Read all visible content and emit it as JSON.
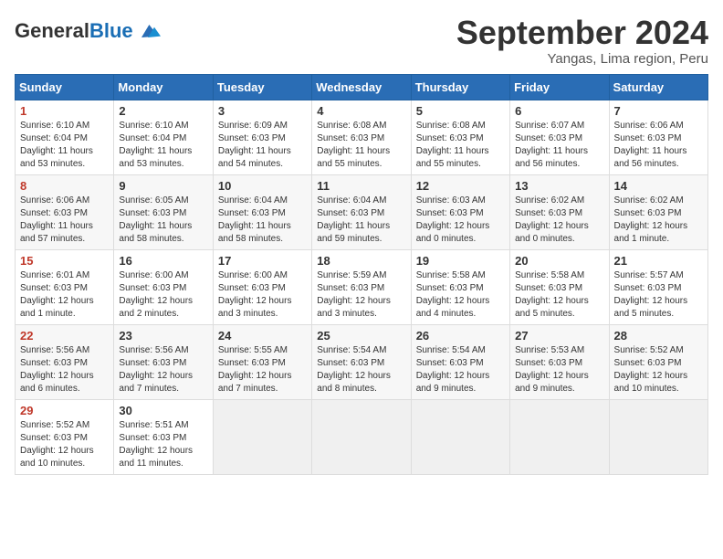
{
  "header": {
    "logo_general": "General",
    "logo_blue": "Blue",
    "month_title": "September 2024",
    "location": "Yangas, Lima region, Peru"
  },
  "calendar": {
    "weekdays": [
      "Sunday",
      "Monday",
      "Tuesday",
      "Wednesday",
      "Thursday",
      "Friday",
      "Saturday"
    ],
    "weeks": [
      [
        {
          "day": "1",
          "info": "Sunrise: 6:10 AM\nSunset: 6:04 PM\nDaylight: 11 hours\nand 53 minutes."
        },
        {
          "day": "2",
          "info": "Sunrise: 6:10 AM\nSunset: 6:04 PM\nDaylight: 11 hours\nand 53 minutes."
        },
        {
          "day": "3",
          "info": "Sunrise: 6:09 AM\nSunset: 6:03 PM\nDaylight: 11 hours\nand 54 minutes."
        },
        {
          "day": "4",
          "info": "Sunrise: 6:08 AM\nSunset: 6:03 PM\nDaylight: 11 hours\nand 55 minutes."
        },
        {
          "day": "5",
          "info": "Sunrise: 6:08 AM\nSunset: 6:03 PM\nDaylight: 11 hours\nand 55 minutes."
        },
        {
          "day": "6",
          "info": "Sunrise: 6:07 AM\nSunset: 6:03 PM\nDaylight: 11 hours\nand 56 minutes."
        },
        {
          "day": "7",
          "info": "Sunrise: 6:06 AM\nSunset: 6:03 PM\nDaylight: 11 hours\nand 56 minutes."
        }
      ],
      [
        {
          "day": "8",
          "info": "Sunrise: 6:06 AM\nSunset: 6:03 PM\nDaylight: 11 hours\nand 57 minutes."
        },
        {
          "day": "9",
          "info": "Sunrise: 6:05 AM\nSunset: 6:03 PM\nDaylight: 11 hours\nand 58 minutes."
        },
        {
          "day": "10",
          "info": "Sunrise: 6:04 AM\nSunset: 6:03 PM\nDaylight: 11 hours\nand 58 minutes."
        },
        {
          "day": "11",
          "info": "Sunrise: 6:04 AM\nSunset: 6:03 PM\nDaylight: 11 hours\nand 59 minutes."
        },
        {
          "day": "12",
          "info": "Sunrise: 6:03 AM\nSunset: 6:03 PM\nDaylight: 12 hours\nand 0 minutes."
        },
        {
          "day": "13",
          "info": "Sunrise: 6:02 AM\nSunset: 6:03 PM\nDaylight: 12 hours\nand 0 minutes."
        },
        {
          "day": "14",
          "info": "Sunrise: 6:02 AM\nSunset: 6:03 PM\nDaylight: 12 hours\nand 1 minute."
        }
      ],
      [
        {
          "day": "15",
          "info": "Sunrise: 6:01 AM\nSunset: 6:03 PM\nDaylight: 12 hours\nand 1 minute."
        },
        {
          "day": "16",
          "info": "Sunrise: 6:00 AM\nSunset: 6:03 PM\nDaylight: 12 hours\nand 2 minutes."
        },
        {
          "day": "17",
          "info": "Sunrise: 6:00 AM\nSunset: 6:03 PM\nDaylight: 12 hours\nand 3 minutes."
        },
        {
          "day": "18",
          "info": "Sunrise: 5:59 AM\nSunset: 6:03 PM\nDaylight: 12 hours\nand 3 minutes."
        },
        {
          "day": "19",
          "info": "Sunrise: 5:58 AM\nSunset: 6:03 PM\nDaylight: 12 hours\nand 4 minutes."
        },
        {
          "day": "20",
          "info": "Sunrise: 5:58 AM\nSunset: 6:03 PM\nDaylight: 12 hours\nand 5 minutes."
        },
        {
          "day": "21",
          "info": "Sunrise: 5:57 AM\nSunset: 6:03 PM\nDaylight: 12 hours\nand 5 minutes."
        }
      ],
      [
        {
          "day": "22",
          "info": "Sunrise: 5:56 AM\nSunset: 6:03 PM\nDaylight: 12 hours\nand 6 minutes."
        },
        {
          "day": "23",
          "info": "Sunrise: 5:56 AM\nSunset: 6:03 PM\nDaylight: 12 hours\nand 7 minutes."
        },
        {
          "day": "24",
          "info": "Sunrise: 5:55 AM\nSunset: 6:03 PM\nDaylight: 12 hours\nand 7 minutes."
        },
        {
          "day": "25",
          "info": "Sunrise: 5:54 AM\nSunset: 6:03 PM\nDaylight: 12 hours\nand 8 minutes."
        },
        {
          "day": "26",
          "info": "Sunrise: 5:54 AM\nSunset: 6:03 PM\nDaylight: 12 hours\nand 9 minutes."
        },
        {
          "day": "27",
          "info": "Sunrise: 5:53 AM\nSunset: 6:03 PM\nDaylight: 12 hours\nand 9 minutes."
        },
        {
          "day": "28",
          "info": "Sunrise: 5:52 AM\nSunset: 6:03 PM\nDaylight: 12 hours\nand 10 minutes."
        }
      ],
      [
        {
          "day": "29",
          "info": "Sunrise: 5:52 AM\nSunset: 6:03 PM\nDaylight: 12 hours\nand 10 minutes."
        },
        {
          "day": "30",
          "info": "Sunrise: 5:51 AM\nSunset: 6:03 PM\nDaylight: 12 hours\nand 11 minutes."
        },
        {
          "day": "",
          "info": ""
        },
        {
          "day": "",
          "info": ""
        },
        {
          "day": "",
          "info": ""
        },
        {
          "day": "",
          "info": ""
        },
        {
          "day": "",
          "info": ""
        }
      ]
    ]
  }
}
